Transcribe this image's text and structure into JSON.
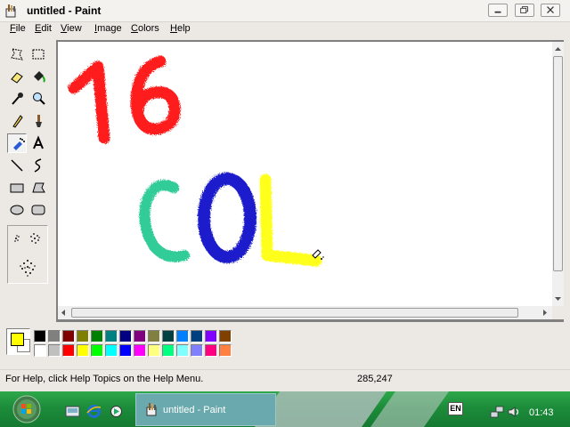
{
  "window": {
    "title": "untitled - Paint"
  },
  "menubar": {
    "items": [
      {
        "label": "File",
        "mnemonic": "F",
        "rest": "ile"
      },
      {
        "label": "Edit",
        "mnemonic": "E",
        "rest": "dit"
      },
      {
        "label": "View",
        "mnemonic": "V",
        "rest": "iew"
      },
      {
        "label": "Image",
        "mnemonic": "I",
        "rest": "mage"
      },
      {
        "label": "Colors",
        "mnemonic": "C",
        "rest": "olors"
      },
      {
        "label": "Help",
        "mnemonic": "H",
        "rest": "elp"
      }
    ]
  },
  "toolbox": {
    "tools": [
      "free-form-select",
      "select",
      "eraser",
      "fill-with-color",
      "pick-color",
      "magnifier",
      "pencil",
      "brush",
      "airbrush",
      "text",
      "line",
      "curve",
      "rectangle",
      "polygon",
      "ellipse",
      "rounded-rectangle"
    ],
    "selected_tool": "airbrush"
  },
  "canvas": {
    "drawing_text_line1": "16",
    "drawing_text_line2": [
      "C",
      "O",
      "L"
    ],
    "stroke_colors": [
      "#ff0000",
      "#33cc99",
      "#1a1acc",
      "#ffff00"
    ]
  },
  "palette": {
    "foreground": "#ffff00",
    "background": "#ffffff",
    "row1": [
      "#000000",
      "#808080",
      "#800000",
      "#808000",
      "#008000",
      "#008080",
      "#000080",
      "#800080",
      "#808040",
      "#004040",
      "#0080ff",
      "#004080",
      "#8000ff",
      "#804000"
    ],
    "row2": [
      "#ffffff",
      "#c0c0c0",
      "#ff0000",
      "#ffff00",
      "#00ff00",
      "#00ffff",
      "#0000ff",
      "#ff00ff",
      "#ffff80",
      "#00ff80",
      "#80ffff",
      "#8080ff",
      "#ff0080",
      "#ff8040"
    ]
  },
  "statusbar": {
    "help_text": "For Help, click Help Topics on the Help Menu.",
    "coords": "285,247"
  },
  "taskbar": {
    "task_label": "untitled - Paint",
    "lang": "EN",
    "clock": "01:43"
  }
}
